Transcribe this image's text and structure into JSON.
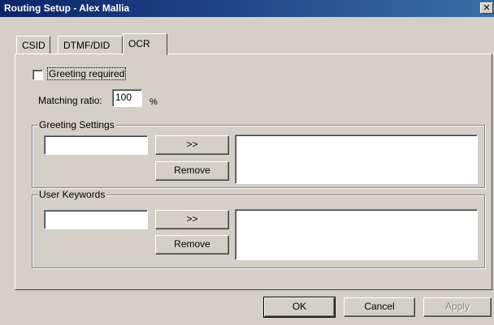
{
  "window": {
    "title": "Routing Setup - Alex Mallia",
    "close_glyph": "✕"
  },
  "tabs": [
    {
      "label": "CSID"
    },
    {
      "label": "DTMF/DID"
    },
    {
      "label": "OCR"
    }
  ],
  "ocr": {
    "greeting_required_label": "Greeting required",
    "greeting_required_checked": false,
    "matching_ratio_label": "Matching ratio:",
    "matching_ratio_value": "100",
    "matching_ratio_unit": "%",
    "greeting_settings": {
      "title": "Greeting Settings",
      "input_value": "",
      "add_label": ">>",
      "remove_label": "Remove"
    },
    "user_keywords": {
      "title": "User Keywords",
      "input_value": "",
      "add_label": ">>",
      "remove_label": "Remove"
    }
  },
  "footer": {
    "ok_label": "OK",
    "cancel_label": "Cancel",
    "apply_label": "Apply"
  }
}
